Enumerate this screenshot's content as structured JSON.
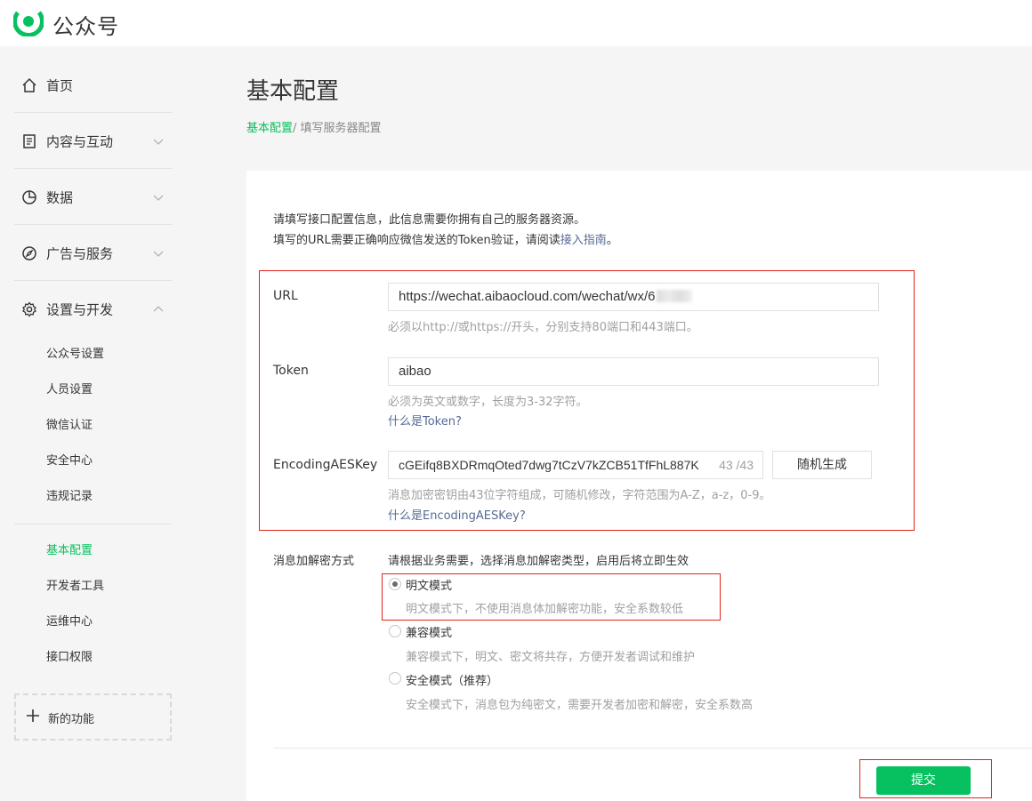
{
  "app": {
    "brand": "公众号"
  },
  "sidebar": {
    "items": [
      {
        "label": "首页",
        "icon": "home-icon"
      },
      {
        "label": "内容与互动",
        "icon": "document-icon"
      },
      {
        "label": "数据",
        "icon": "pie-chart-icon"
      },
      {
        "label": "广告与服务",
        "icon": "compass-icon"
      },
      {
        "label": "设置与开发",
        "icon": "gear-icon"
      }
    ],
    "settings_sub": [
      "公众号设置",
      "人员设置",
      "微信认证",
      "安全中心",
      "违规记录"
    ],
    "dev_sub": [
      "基本配置",
      "开发者工具",
      "运维中心",
      "接口权限"
    ],
    "new_feature": "新的功能"
  },
  "page": {
    "title": "基本配置",
    "breadcrumb": {
      "parent": "基本配置",
      "current": "/ 填写服务器配置"
    }
  },
  "intro": {
    "line1": "请填写接口配置信息，此信息需要你拥有自己的服务器资源。",
    "line2_prefix": "填写的URL需要正确响应微信发送的Token验证，请阅读",
    "line2_link": "接入指南",
    "line2_suffix": "。"
  },
  "form": {
    "url": {
      "label": "URL",
      "value": "https://wechat.aibaocloud.com/wechat/wx/6",
      "hint": "必须以http://或https://开头，分别支持80端口和443端口。"
    },
    "token": {
      "label": "Token",
      "value": "aibao",
      "hint": "必须为英文或数字，长度为3-32字符。",
      "help": "什么是Token?"
    },
    "aes": {
      "label": "EncodingAESKey",
      "value": "cGEifq8BXDRmqOted7dwg7tCzV7kZCB51TfFhL887K",
      "counter": "43 /43",
      "generate_button": "随机生成",
      "hint": "消息加密密钥由43位字符组成，可随机修改，字符范围为A-Z，a-z，0-9。",
      "help": "什么是EncodingAESKey?"
    },
    "encryption": {
      "label": "消息加解密方式",
      "desc": "请根据业务需要，选择消息加解密类型，启用后将立即生效",
      "options": [
        {
          "label": "明文模式",
          "desc": "明文模式下，不使用消息体加解密功能，安全系数较低",
          "checked": true
        },
        {
          "label": "兼容模式",
          "desc": "兼容模式下，明文、密文将共存，方便开发者调试和维护",
          "checked": false
        },
        {
          "label": "安全模式（推荐）",
          "desc": "安全模式下，消息包为纯密文，需要开发者加密和解密，安全系数高",
          "checked": false
        }
      ]
    },
    "submit": "提交"
  },
  "colors": {
    "accent": "#07c160",
    "link": "#576b95",
    "highlight": "#e1251b",
    "background": "#f5f5f5"
  }
}
